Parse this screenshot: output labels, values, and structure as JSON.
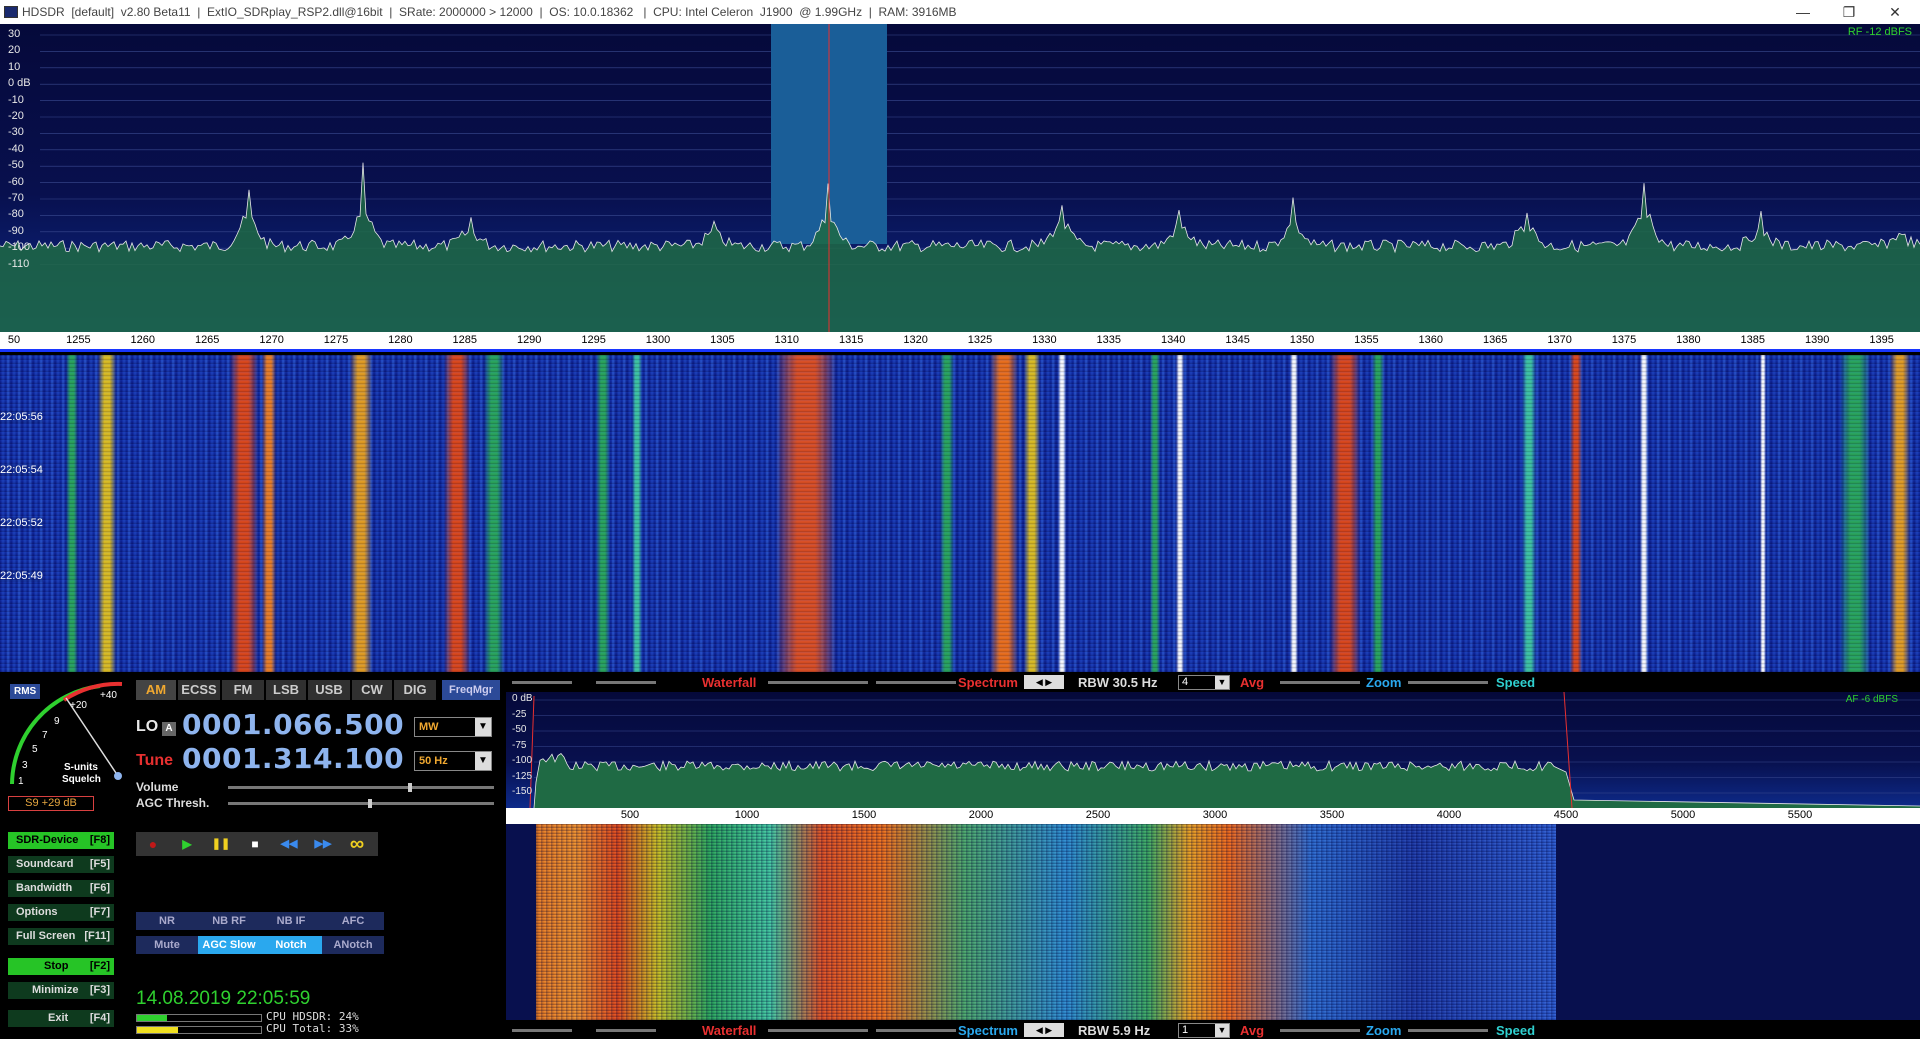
{
  "window": {
    "title": "HDSDR  [default]  v2.80 Beta11  |  ExtIO_SDRplay_RSP2.dll@16bit  |  SRate: 2000000 > 12000  |  OS: 10.0.18362   |  CPU: Intel Celeron  J1900  @ 1.99GHz  |  RAM: 3916MB",
    "minimize": "—",
    "restore": "❐",
    "close": "✕"
  },
  "rf_spectrum": {
    "level_label": "RF -12 dBFS",
    "db_ticks": [
      "30",
      "20",
      "10",
      "0 dB",
      "-10",
      "-20",
      "-30",
      "-40",
      "-50",
      "-60",
      "-70",
      "-80",
      "-90",
      "-100",
      "-110"
    ],
    "freq_ticks": [
      "50",
      "1255",
      "1260",
      "1265",
      "1270",
      "1275",
      "1280",
      "1285",
      "1290",
      "1295",
      "1300",
      "1305",
      "1310",
      "1315",
      "1320",
      "1325",
      "1330",
      "1335",
      "1340",
      "1345",
      "1350",
      "1355",
      "1360",
      "1365",
      "1370",
      "1375",
      "1380",
      "1385",
      "1390",
      "1395"
    ]
  },
  "waterfall": {
    "timestamps": [
      "22:05:56",
      "22:05:54",
      "22:05:52",
      "22:05:49"
    ]
  },
  "smeter": {
    "rms": "RMS",
    "scale": [
      "1",
      "3",
      "5",
      "7",
      "9",
      "+20",
      "+40"
    ],
    "caption": "S-units",
    "squelch": "Squelch",
    "reading": "S9 +29 dB"
  },
  "side_buttons": [
    {
      "label": "SDR-Device",
      "key": "[F8]"
    },
    {
      "label": "Soundcard",
      "key": "[F5]"
    },
    {
      "label": "Bandwidth",
      "key": "[F6]"
    },
    {
      "label": "Options",
      "key": "[F7]"
    },
    {
      "label": "Full Screen",
      "key": "[F11]"
    },
    {
      "label": "Stop",
      "key": "[F2]"
    },
    {
      "label": "Minimize",
      "key": "[F3]"
    },
    {
      "label": "Exit",
      "key": "[F4]"
    }
  ],
  "modes": [
    "AM",
    "ECSS",
    "FM",
    "LSB",
    "USB",
    "CW",
    "DIG"
  ],
  "selected_mode": "AM",
  "freqmgr": "FreqMgr",
  "lo": {
    "label": "LO",
    "badge": "A",
    "value": "0001.066.500",
    "band": "MW"
  },
  "tune": {
    "label": "Tune",
    "value": "0001.314.100",
    "step": "50 Hz"
  },
  "volume_label": "Volume",
  "agc_label": "AGC Thresh.",
  "transport": {
    "record": "●",
    "play": "▶",
    "pause": "❚❚",
    "stop": "■",
    "rewind": "◀◀",
    "forward": "▶▶",
    "loop": "∞"
  },
  "dsp_row1": [
    "NR",
    "NB RF",
    "NB IF",
    "AFC"
  ],
  "dsp_row2": [
    "Mute",
    "AGC Slow",
    "Notch",
    "ANotch"
  ],
  "datetime": "14.08.2019 22:05:59",
  "cpu": {
    "hdsdr": "CPU HDSDR: 24%",
    "total": "CPU Total: 33%",
    "hdsdr_fraction": 0.24,
    "total_fraction": 0.33
  },
  "af_bar_top": {
    "waterfall": "Waterfall",
    "spectrum": "Spectrum",
    "rbw": "RBW 30.5 Hz",
    "avg_value": "4",
    "avg": "Avg",
    "zoom": "Zoom",
    "speed": "Speed",
    "nav": "◀ ▶"
  },
  "af_bar_bottom": {
    "waterfall": "Waterfall",
    "spectrum": "Spectrum",
    "rbw": "RBW  5.9 Hz",
    "avg_value": "1",
    "avg": "Avg",
    "zoom": "Zoom",
    "speed": "Speed",
    "nav": "◀ ▶"
  },
  "af_spectrum": {
    "level_label": "AF  -6 dBFS",
    "db_ticks": [
      "0 dB",
      "-25",
      "-50",
      "-75",
      "-100",
      "-125",
      "-150"
    ],
    "freq_ticks": [
      "500",
      "1000",
      "1500",
      "2000",
      "2500",
      "3000",
      "3500",
      "4000",
      "4500",
      "5000",
      "5500"
    ]
  },
  "colors": {
    "accent_green": "#2fd02f",
    "mode_orange": "#f0a830",
    "tune_red": "#e83030",
    "lo_white": "#e8e8e8",
    "digits_blue": "#8eb4ee"
  }
}
